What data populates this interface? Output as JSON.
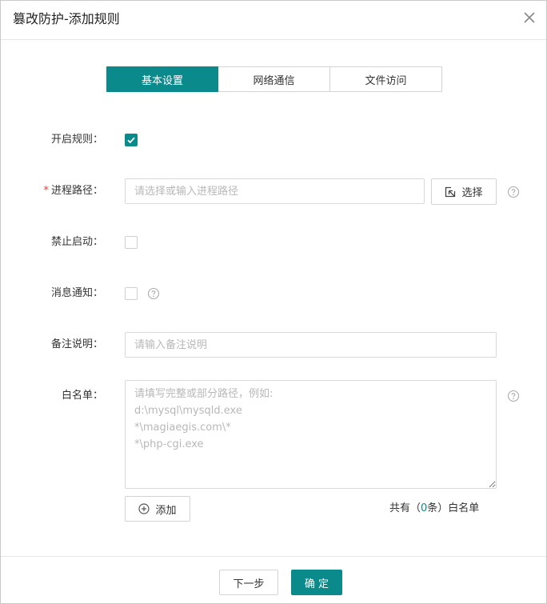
{
  "dialog": {
    "title": "篡改防护-添加规则",
    "close_icon": "close-icon"
  },
  "tabs": [
    {
      "label": "基本设置",
      "active": true
    },
    {
      "label": "网络通信",
      "active": false
    },
    {
      "label": "文件访问",
      "active": false
    }
  ],
  "form": {
    "enable_rule": {
      "label": "开启规则：",
      "checked": true
    },
    "process_path": {
      "required_mark": "*",
      "label": "进程路径：",
      "placeholder": "请选择或输入进程路径",
      "value": "",
      "select_button": "选择",
      "select_icon": "cursor-select-icon"
    },
    "forbid_start": {
      "label": "禁止启动：",
      "checked": false
    },
    "message_notify": {
      "label": "消息通知：",
      "checked": false
    },
    "remark": {
      "label": "备注说明：",
      "placeholder": "请输入备注说明",
      "value": ""
    },
    "whitelist": {
      "label": "白名单：",
      "placeholder": "请填写完整或部分路径，例如:\nd:\\mysql\\mysqld.exe\n*\\magiaegis.com\\*\n*\\php-cgi.exe",
      "value": "",
      "add_button": "添加",
      "add_icon": "plus-circle-icon",
      "count_prefix": "共有（",
      "count_value": "0",
      "count_suffix": "条）白名单"
    }
  },
  "footer": {
    "next_button": "下一步",
    "confirm_button": "确 定"
  },
  "colors": {
    "accent": "#0b8a8c",
    "required": "#e53935",
    "border": "#d9d9d9",
    "placeholder": "#b8b8b8"
  }
}
